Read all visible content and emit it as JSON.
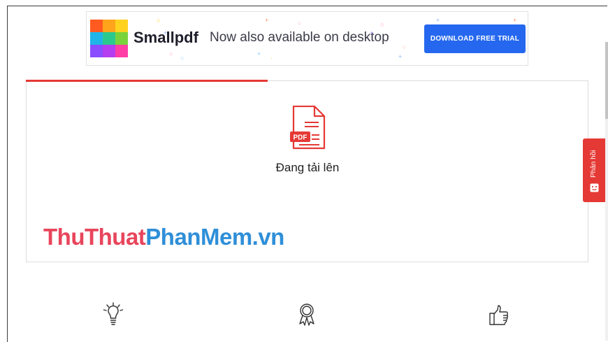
{
  "banner": {
    "brand": "Smallpdf",
    "tagline": "Now also available on desktop",
    "cta_label": "DOWNLOAD FREE TRIAL",
    "logo_colors": [
      "#ff5a1f",
      "#ffa41b",
      "#ffd21f",
      "#1fb5e8",
      "#2cc98f",
      "#7ad33c",
      "#8a4dff",
      "#b43ef0",
      "#ff3fa6"
    ],
    "cta_color": "#2568ef"
  },
  "upload": {
    "status_label": "Đang tải lên",
    "file_icon": "pdf-file-icon",
    "file_badge": "PDF",
    "progress": 0.43,
    "accent_color": "#e53935"
  },
  "watermark": {
    "part1": "ThuThuat",
    "part2": "PhanMem.vn"
  },
  "feedback": {
    "label": "Phản hồi"
  },
  "features": [
    {
      "icon": "lightbulb-icon"
    },
    {
      "icon": "award-ribbon-icon"
    },
    {
      "icon": "thumbs-up-icon"
    }
  ]
}
